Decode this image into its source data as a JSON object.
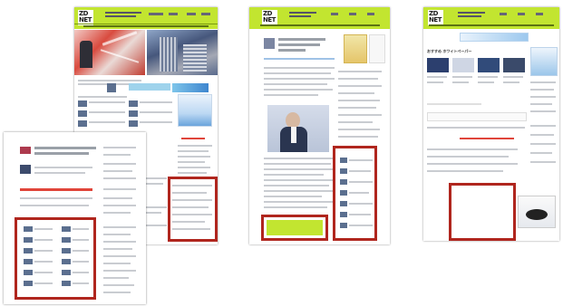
{
  "brand": {
    "logo_line1": "ZD",
    "logo_line2": "NET",
    "accent": "#c2e530",
    "highlight": "#b0261e"
  },
  "pages": [
    {
      "name": "top-page",
      "heading": ""
    },
    {
      "name": "article-page",
      "heading": ""
    },
    {
      "name": "category-page",
      "heading": "おすすめ ホワイトペーパー"
    },
    {
      "name": "mobile-page",
      "heading": ""
    }
  ]
}
